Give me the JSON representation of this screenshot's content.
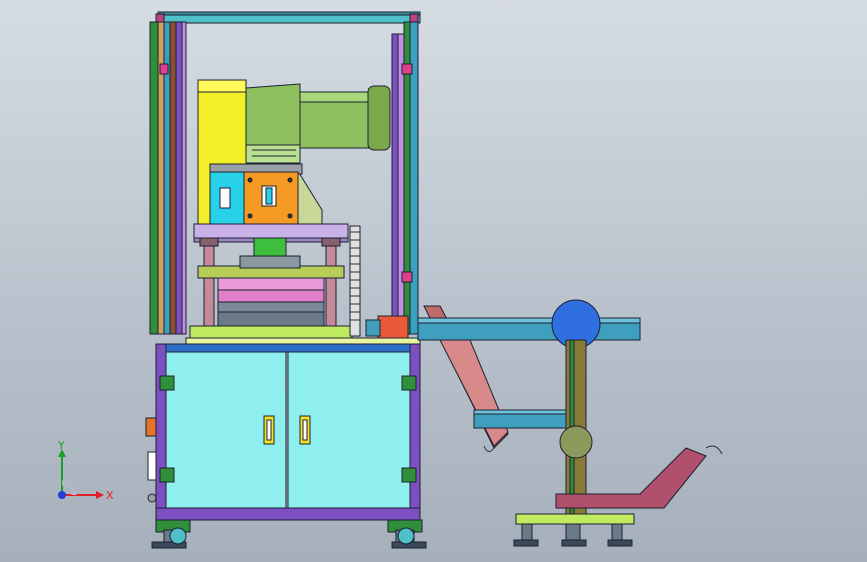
{
  "viewport": {
    "background": "#b9c2cc",
    "view": "front"
  },
  "triad": {
    "x_label": "X",
    "y_label": "Y",
    "x_color": "#e0202a",
    "y_color": "#18a02a",
    "z_color": "#1f3fd8"
  },
  "colors": {
    "frame_blue": "#2f6fc9",
    "frame_purple": "#7d4fc0",
    "frame_green": "#2f8f3a",
    "cabinet_cyan": "#8fefef",
    "column_yellow": "#f4f028",
    "cylinder_green": "#8fc060",
    "block_orange": "#f59a24",
    "block_cyan": "#28d0e8",
    "plate_lavender": "#c9b2e8",
    "die_pink": "#e89ad8",
    "conveyor_teal": "#3f9fbf",
    "roller_blue": "#2f6fe0",
    "chute_red": "#c06a6a",
    "hopper_magenta": "#b0506c",
    "post_olive": "#8a7a3a"
  }
}
